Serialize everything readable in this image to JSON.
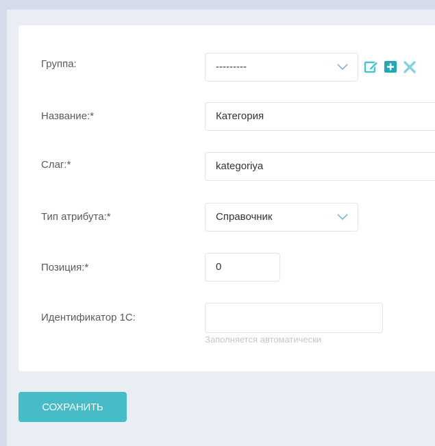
{
  "form": {
    "group": {
      "label": "Группа:",
      "value": "---------",
      "icons": [
        "edit-icon",
        "add-icon",
        "delete-icon"
      ]
    },
    "name": {
      "label": "Название:*",
      "value": "Категория"
    },
    "slug": {
      "label": "Слаг:*",
      "value": "kategoriya"
    },
    "attribute_type": {
      "label": "Тип атрибута:*",
      "value": "Справочник"
    },
    "position": {
      "label": "Позиция:*",
      "value": "0"
    },
    "identifier_1c": {
      "label": "Идентификатор 1С:",
      "value": "",
      "hint": "Заполняется автоматически"
    }
  },
  "actions": {
    "save_label": "СОХРАНИТЬ"
  },
  "colors": {
    "accent": "#45bcc7",
    "page_background": "#e9eef4",
    "card_background": "#ffffff",
    "label_text": "#555b63",
    "hint_text": "#c2c7cc"
  }
}
